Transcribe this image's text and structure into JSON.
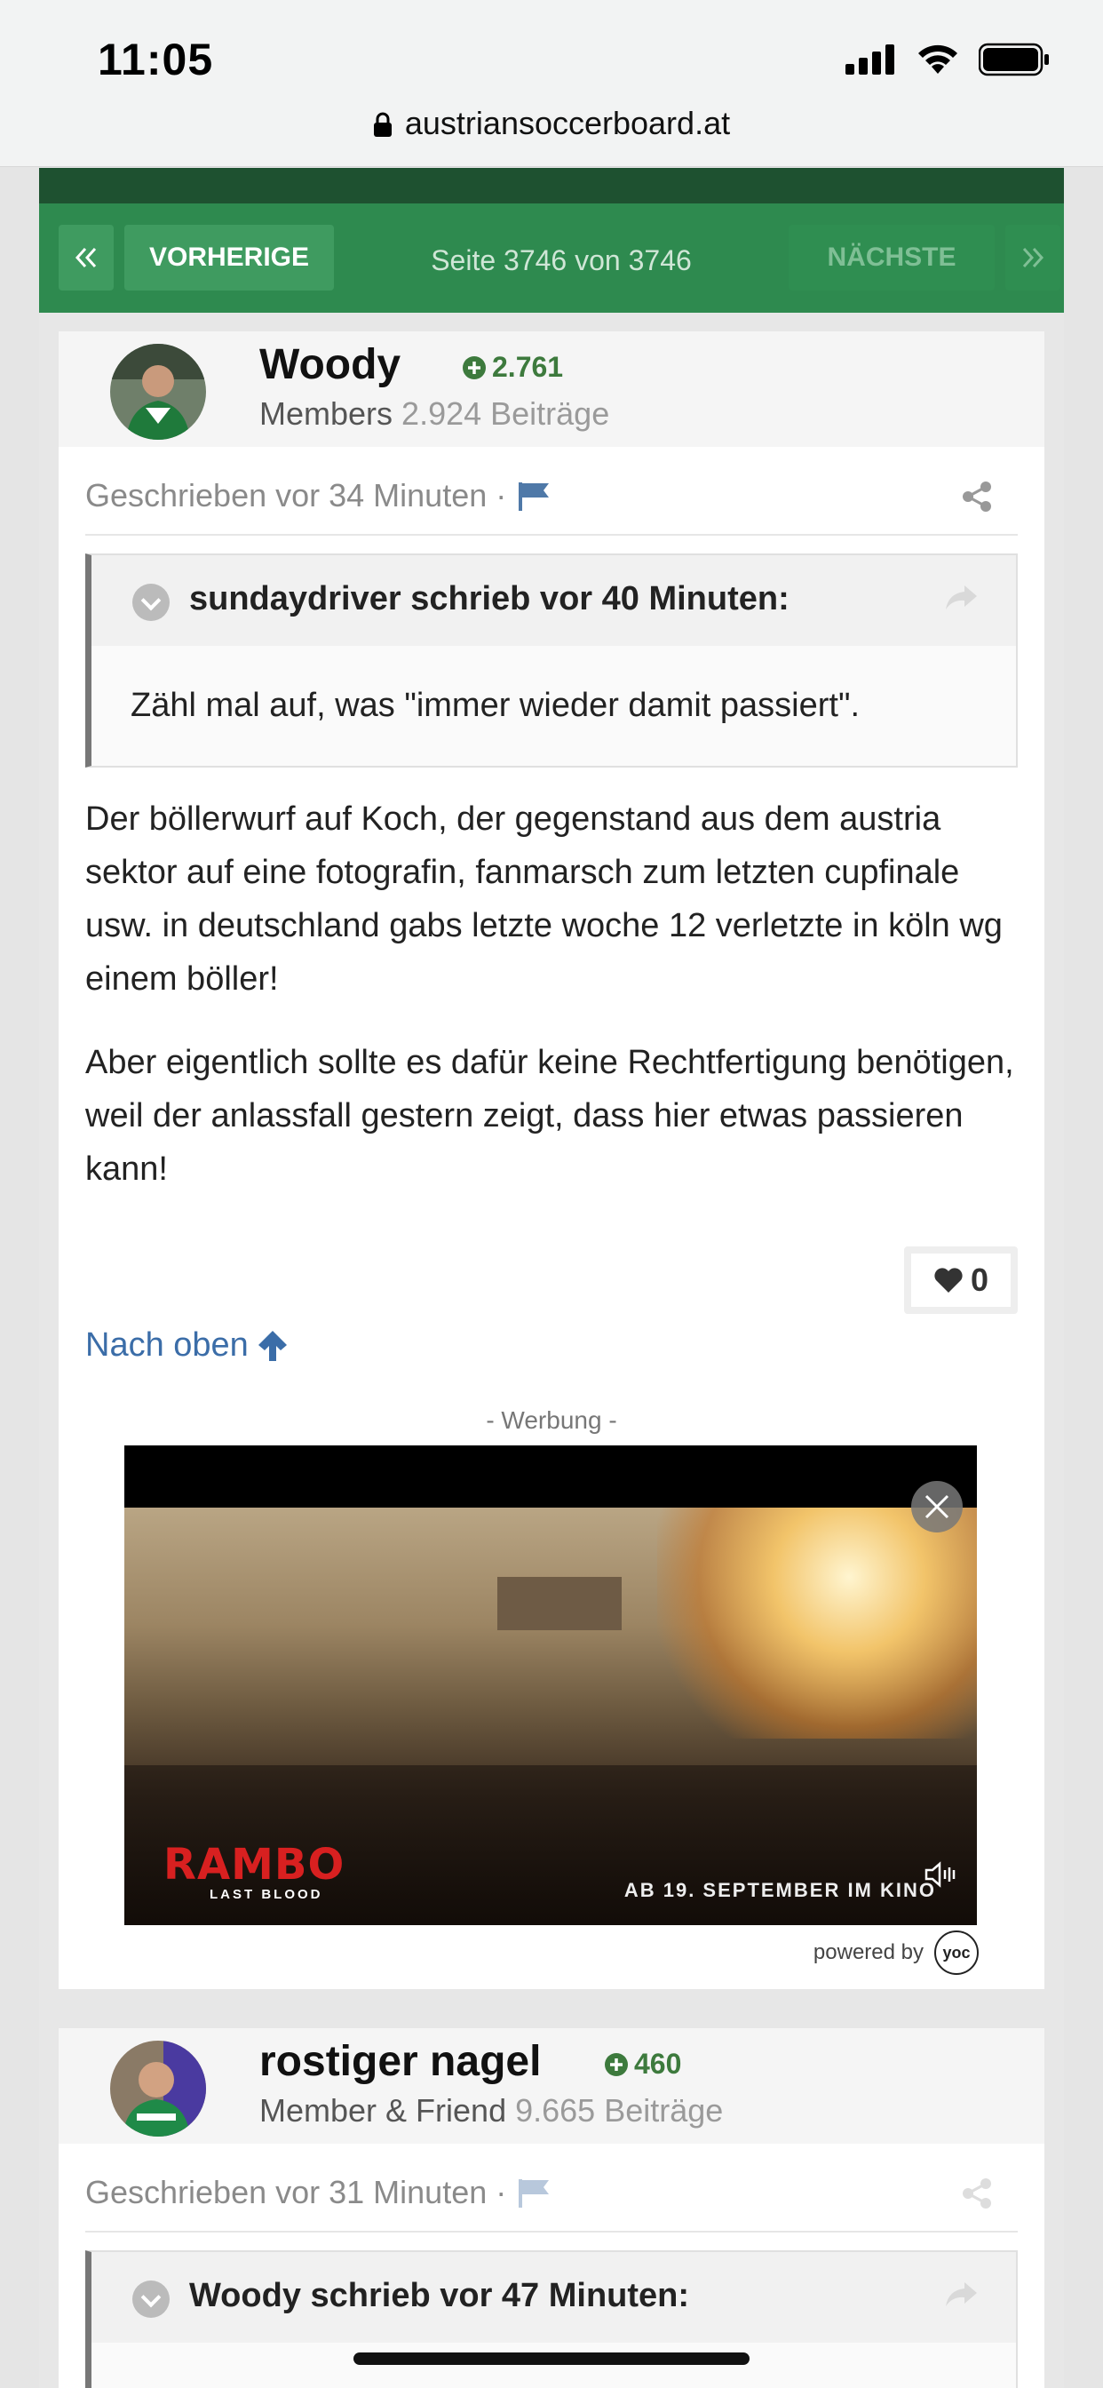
{
  "status": {
    "time": "11:05"
  },
  "browser": {
    "url": "austriansoccerboard.at"
  },
  "pager": {
    "prev_label": "VORHERIGE",
    "next_label": "NÄCHSTE",
    "page_text": "Seite 3746 von 3746"
  },
  "posts": [
    {
      "author": "Woody",
      "reputation": "2.761",
      "role": "Members",
      "post_count": "2.924 Beiträge",
      "posted": "Geschrieben vor 34 Minuten ·",
      "quote": {
        "title": "sundaydriver schrieb vor 40 Minuten:",
        "body": "Zähl mal auf, was \"immer wieder damit passiert\"."
      },
      "paragraphs": [
        "Der böllerwurf auf Koch, der gegenstand aus dem austria sektor auf eine fotografin, fanmarsch zum letzten cupfinale usw. in deutschland gabs letzte woche 12 verletzte in köln wg einem böller!",
        "Aber eigentlich sollte es dafür keine Rechtfertigung benötigen, weil der anlassfall gestern zeigt, dass hier etwas passieren kann!"
      ],
      "likes": "0",
      "to_top": "Nach oben"
    },
    {
      "author": "rostiger nagel",
      "reputation": "460",
      "role": "Member & Friend",
      "post_count": "9.665 Beiträge",
      "posted": "Geschrieben vor 31 Minuten ·",
      "quote": {
        "title": "Woody schrieb vor 47 Minuten:"
      }
    }
  ],
  "ad": {
    "label": "- Werbung -",
    "brand": "RAMBO",
    "brand_sub": "LAST BLOOD",
    "tagline": "AB 19. SEPTEMBER IM KINO",
    "powered_by": "powered by",
    "provider": "yoc"
  },
  "colors": {
    "pager_green": "#2e8a4f",
    "dark_green": "#1e5130",
    "link_blue": "#3b6da8",
    "rep_green": "#3d7a3d"
  }
}
